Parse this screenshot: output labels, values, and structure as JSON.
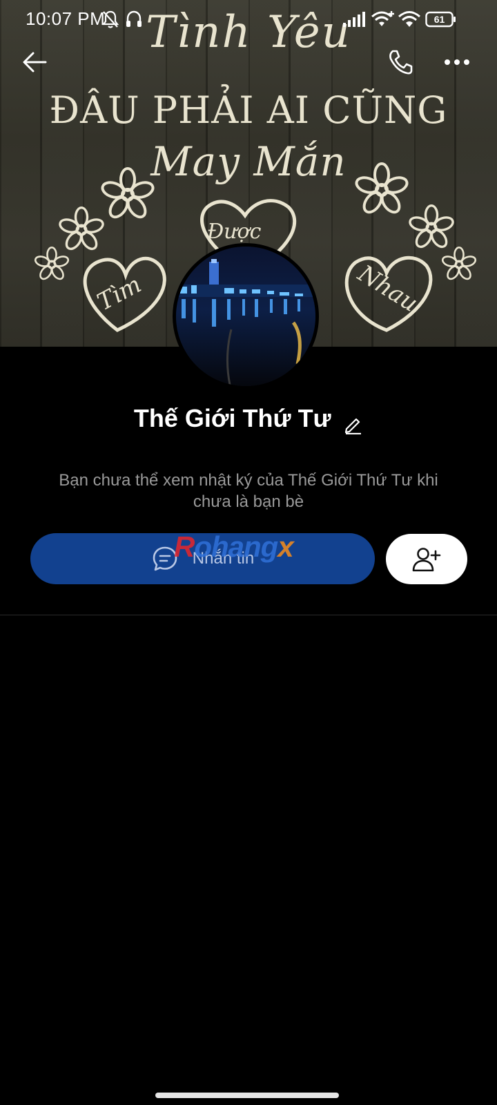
{
  "status_bar": {
    "time": "10:07 PM",
    "battery": "61",
    "icons": [
      "mute-bell-icon",
      "headset-icon",
      "signal-icon",
      "wifi-plus-icon",
      "wifi-icon",
      "battery-icon"
    ]
  },
  "nav": {
    "icons": [
      "back-arrow-icon",
      "phone-icon",
      "more-icon"
    ]
  },
  "cover": {
    "line1": "Tình Yêu",
    "line2": "ĐÂU PHẢI AI CŨNG",
    "line3": "May Mắn",
    "heart_words": [
      "Tìm",
      "Được",
      "Nhau"
    ]
  },
  "profile": {
    "name": "Thế Giới Thứ Tư",
    "info": "Bạn chưa thể xem nhật ký của Thế Giới Thứ Tư khi chưa là bạn bè"
  },
  "actions": {
    "message_label": "Nhắn tin",
    "message_icon": "chat-bubble-icon",
    "add_friend_icon": "add-friend-icon"
  },
  "watermark": {
    "part_a": "R",
    "part_b": "ohang",
    "part_c": "x"
  },
  "colors": {
    "background": "#000000",
    "message_button": "#12418f",
    "info_text": "#9a9a9a"
  }
}
